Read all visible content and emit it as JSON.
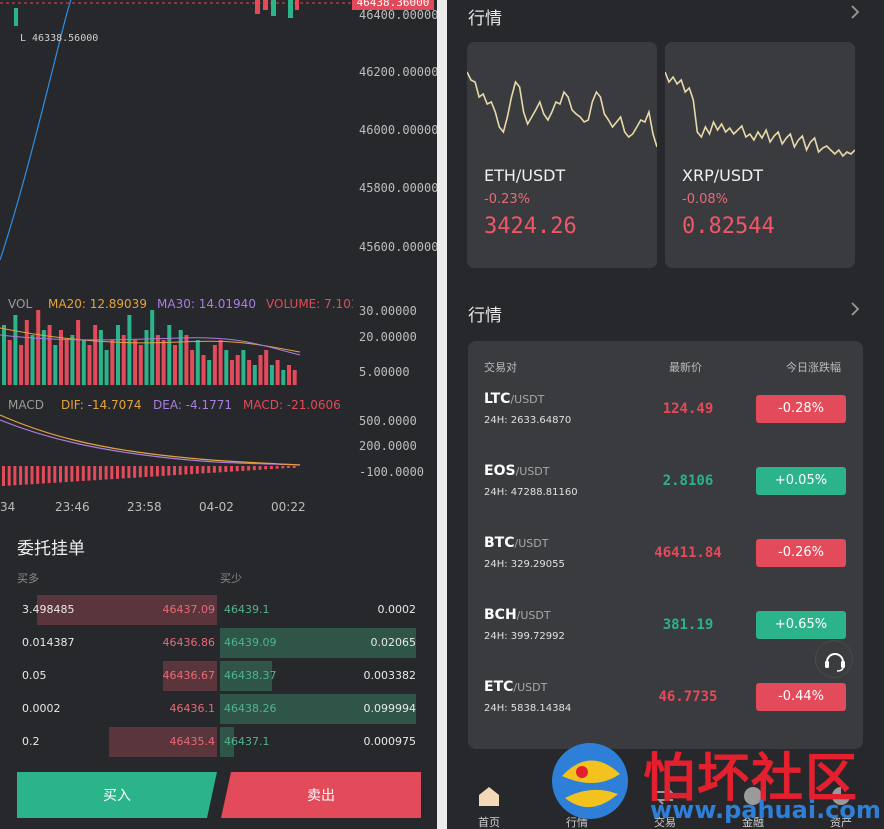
{
  "chart": {
    "current_price": "46438.36000",
    "low_marker": "L 46338.56000",
    "price_axis": [
      "46400.00000",
      "46200.00000",
      "46000.00000",
      "45800.00000",
      "45600.00000"
    ],
    "vol_axis": [
      "30.00000",
      "20.00000",
      "5.00000"
    ],
    "macd_axis": [
      "500.0000",
      "200.0000",
      "-100.0000"
    ],
    "time_axis": [
      "34",
      "23:46",
      "23:58",
      "04-02",
      "00:22"
    ],
    "vol_indicators": {
      "vol": "VOL",
      "ma20": "MA20: 12.89039",
      "ma30": "MA30: 14.01940",
      "volume": "VOLUME: 7.103"
    },
    "macd_indicators": {
      "macd": "MACD",
      "dif": "DIF: -14.7074",
      "dea": "DEA: -4.1771",
      "macd_val": "MACD: -21.0606"
    },
    "colors": {
      "up": "#2bb38a",
      "down": "#e34a5a",
      "ma20": "#e6a23c",
      "ma30": "#a87ee0",
      "volume": "#e34a5a",
      "blue_line": "#2f8fe6"
    }
  },
  "orderbook": {
    "title": "委托挂单",
    "buy_header": "买多",
    "sell_header": "买少",
    "rows": [
      {
        "buy_amount": "3.498485",
        "buy_price": "46437.09",
        "sell_price": "46439.1",
        "sell_amount": "0.0002",
        "bid_depth": 0.9,
        "ask_depth": 0.0
      },
      {
        "buy_amount": "0.014387",
        "buy_price": "46436.86",
        "sell_price": "46439.09",
        "sell_amount": "0.02065",
        "bid_depth": 0.0,
        "ask_depth": 0.98
      },
      {
        "buy_amount": "0.05",
        "buy_price": "46436.67",
        "sell_price": "46438.37",
        "sell_amount": "0.003382",
        "bid_depth": 0.27,
        "ask_depth": 0.26
      },
      {
        "buy_amount": "0.0002",
        "buy_price": "46436.1",
        "sell_price": "46438.26",
        "sell_amount": "0.099994",
        "bid_depth": 0.0,
        "ask_depth": 0.98
      },
      {
        "buy_amount": "0.2",
        "buy_price": "46435.4",
        "sell_price": "46437.1",
        "sell_amount": "0.000975",
        "bid_depth": 0.54,
        "ask_depth": 0.07
      }
    ],
    "buy_button": "买入",
    "sell_button": "卖出"
  },
  "quotes": {
    "title": "行情",
    "cards": [
      {
        "pair": "ETH/USDT",
        "change": "-0.23%",
        "price": "3424.26",
        "spark": [
          30,
          38,
          40,
          55,
          52,
          62,
          60,
          70,
          85,
          90,
          75,
          55,
          40,
          45,
          70,
          82,
          75,
          68,
          60,
          72,
          78,
          70,
          60,
          62,
          50,
          55,
          68,
          72,
          75,
          80,
          78,
          60,
          50,
          55,
          72,
          78,
          85,
          80,
          75,
          90,
          95,
          92,
          85,
          78,
          80,
          70,
          92,
          105
        ]
      },
      {
        "pair": "XRP/USDT",
        "change": "-0.08%",
        "price": "0.82544",
        "spark": [
          30,
          40,
          35,
          42,
          38,
          50,
          46,
          58,
          90,
          95,
          85,
          92,
          80,
          88,
          82,
          90,
          86,
          92,
          88,
          84,
          95,
          92,
          98,
          90,
          96,
          88,
          100,
          94,
          90,
          102,
          96,
          92,
          105,
          98,
          94,
          108,
          100,
          96,
          110,
          106,
          104,
          108,
          112,
          108,
          114,
          110,
          112,
          108
        ]
      }
    ]
  },
  "market": {
    "title": "行情",
    "headers": {
      "pair": "交易对",
      "price": "最新价",
      "change": "今日涨跌幅"
    },
    "rows": [
      {
        "base": "LTC",
        "quote": "/USDT",
        "vol": "24H: 2633.64870",
        "price": "124.49",
        "change": "-0.28%",
        "dir": "down"
      },
      {
        "base": "EOS",
        "quote": "/USDT",
        "vol": "24H: 47288.81160",
        "price": "2.8106",
        "change": "+0.05%",
        "dir": "up"
      },
      {
        "base": "BTC",
        "quote": "/USDT",
        "vol": "24H: 329.29055",
        "price": "46411.84",
        "change": "-0.26%",
        "dir": "down"
      },
      {
        "base": "BCH",
        "quote": "/USDT",
        "vol": "24H: 399.72992",
        "price": "381.19",
        "change": "+0.65%",
        "dir": "up"
      },
      {
        "base": "ETC",
        "quote": "/USDT",
        "vol": "24H: 5838.14384",
        "price": "46.7735",
        "change": "-0.44%",
        "dir": "down"
      }
    ]
  },
  "tabbar": [
    "首页",
    "行情",
    "交易",
    "金融",
    "资产"
  ],
  "watermark": {
    "text": "怕坏社区",
    "url": "www.pahuai.com"
  },
  "icons": [
    "headset-icon",
    "chevron-right-icon",
    "home-icon",
    "quotes-icon",
    "trade-icon",
    "finance-icon",
    "assets-icon"
  ]
}
